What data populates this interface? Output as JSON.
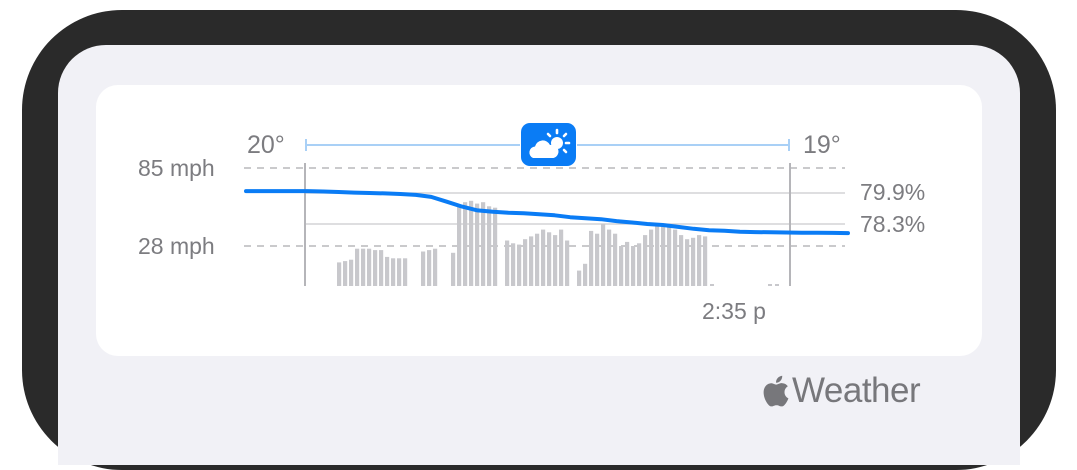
{
  "widget": {
    "temp_start": "20°",
    "temp_end": "19°",
    "condition_icon": "partly-cloudy-sun-icon",
    "wind_high_label": "85 mph",
    "wind_low_label": "28 mph",
    "humidity_high_label": "79.9%",
    "humidity_low_label": "78.3%",
    "time_label": "2:35 p"
  },
  "brand": {
    "logo_icon": "apple-logo-icon",
    "name": "Weather"
  },
  "colors": {
    "accent_blue": "#0a7cf5",
    "bar_gray": "#c8c8cc",
    "timeline_light_blue": "#a9d0f6",
    "device_frame": "#2a2a2a",
    "screen_bg": "#f1f1f6"
  },
  "chart_data": {
    "type": "bar",
    "wind_bars": [
      16,
      17,
      18,
      26,
      26,
      26,
      25,
      25,
      20,
      19,
      19,
      19,
      null,
      null,
      24,
      25,
      26,
      null,
      null,
      23,
      57,
      60,
      61,
      59,
      60,
      57,
      56,
      null,
      32,
      30,
      29,
      33,
      35,
      37,
      40,
      38,
      36,
      40,
      32,
      null,
      10,
      15,
      39,
      37,
      44,
      40,
      37,
      28,
      31,
      28,
      30,
      36,
      40,
      44,
      43,
      44,
      40,
      36,
      33,
      34,
      36,
      35
    ],
    "humidity_line": [
      80.0,
      80.0,
      80.0,
      80.0,
      80.0,
      79.98,
      79.95,
      79.92,
      79.9,
      79.88,
      79.85,
      79.8,
      79.7,
      79.45,
      79.2,
      79.0,
      78.93,
      78.88,
      78.85,
      78.8,
      78.75,
      78.65,
      78.6,
      78.55,
      78.45,
      78.38,
      78.3,
      78.25,
      78.15,
      78.05,
      77.98,
      77.95,
      77.9,
      77.88,
      77.87,
      77.86,
      77.85,
      77.85,
      77.84,
      77.83
    ]
  }
}
